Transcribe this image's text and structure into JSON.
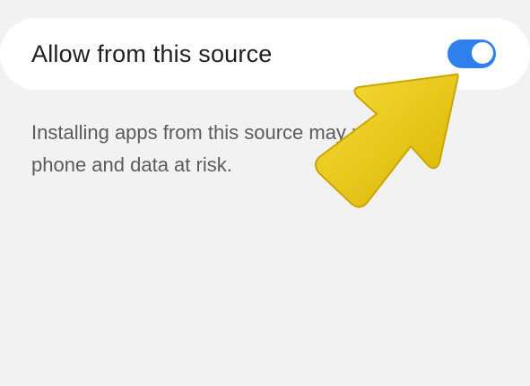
{
  "setting": {
    "label": "Allow from this source",
    "toggle_state": "on"
  },
  "warning": {
    "text": "Installing apps from this source may put your phone and data at risk."
  },
  "colors": {
    "background": "#f2f2f2",
    "card": "#ffffff",
    "toggle_on": "#2f80ed",
    "arrow": "#f0c800"
  },
  "annotation": {
    "icon": "arrow-pointer-icon"
  }
}
